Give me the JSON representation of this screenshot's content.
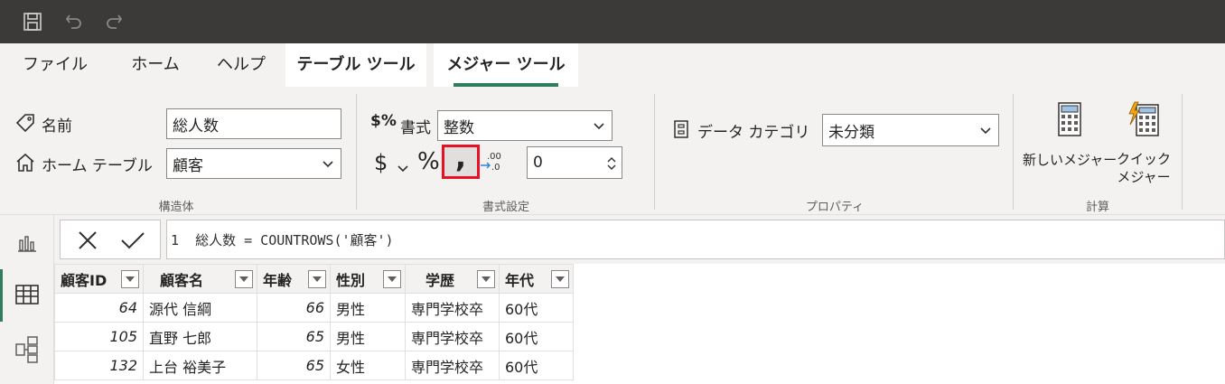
{
  "tabs": [
    {
      "label": "ファイル"
    },
    {
      "label": "ホーム"
    },
    {
      "label": "ヘルプ"
    },
    {
      "label": "テーブル ツール"
    },
    {
      "label": "メジャー ツール"
    }
  ],
  "structure": {
    "name_label": "名前",
    "name_value": "総人数",
    "home_table_label": "ホーム テーブル",
    "home_table_value": "顧客",
    "group_label": "構造体"
  },
  "formatting": {
    "format_label": "書式",
    "format_value": "整数",
    "currency_symbol": "$",
    "percent_symbol": "%",
    "comma_symbol": ",",
    "decimal_places": "0",
    "group_label": "書式設定"
  },
  "properties": {
    "data_category_label": "データ カテゴリ",
    "data_category_value": "未分類",
    "group_label": "プロパティ"
  },
  "calculations": {
    "new_measure_label": "新しいメジャー",
    "quick_measure_label_1": "クイック",
    "quick_measure_label_2": "メジャー",
    "group_label": "計算"
  },
  "formula": {
    "line_number": "1",
    "text": "総人数 = COUNTROWS('顧客')"
  },
  "table": {
    "columns": [
      "顧客ID",
      "顧客名",
      "年齢",
      "性別",
      "学歴",
      "年代"
    ],
    "rows": [
      [
        "64",
        "源代 信綱",
        "66",
        "男性",
        "専門学校卒",
        "60代"
      ],
      [
        "105",
        "直野 七郎",
        "65",
        "男性",
        "専門学校卒",
        "60代"
      ],
      [
        "132",
        "上台 裕美子",
        "65",
        "女性",
        "専門学校卒",
        "60代"
      ]
    ]
  },
  "colors": {
    "titlebar": "#3b3a39",
    "accent": "#2e7d5b",
    "highlight_box": "#e81123"
  }
}
